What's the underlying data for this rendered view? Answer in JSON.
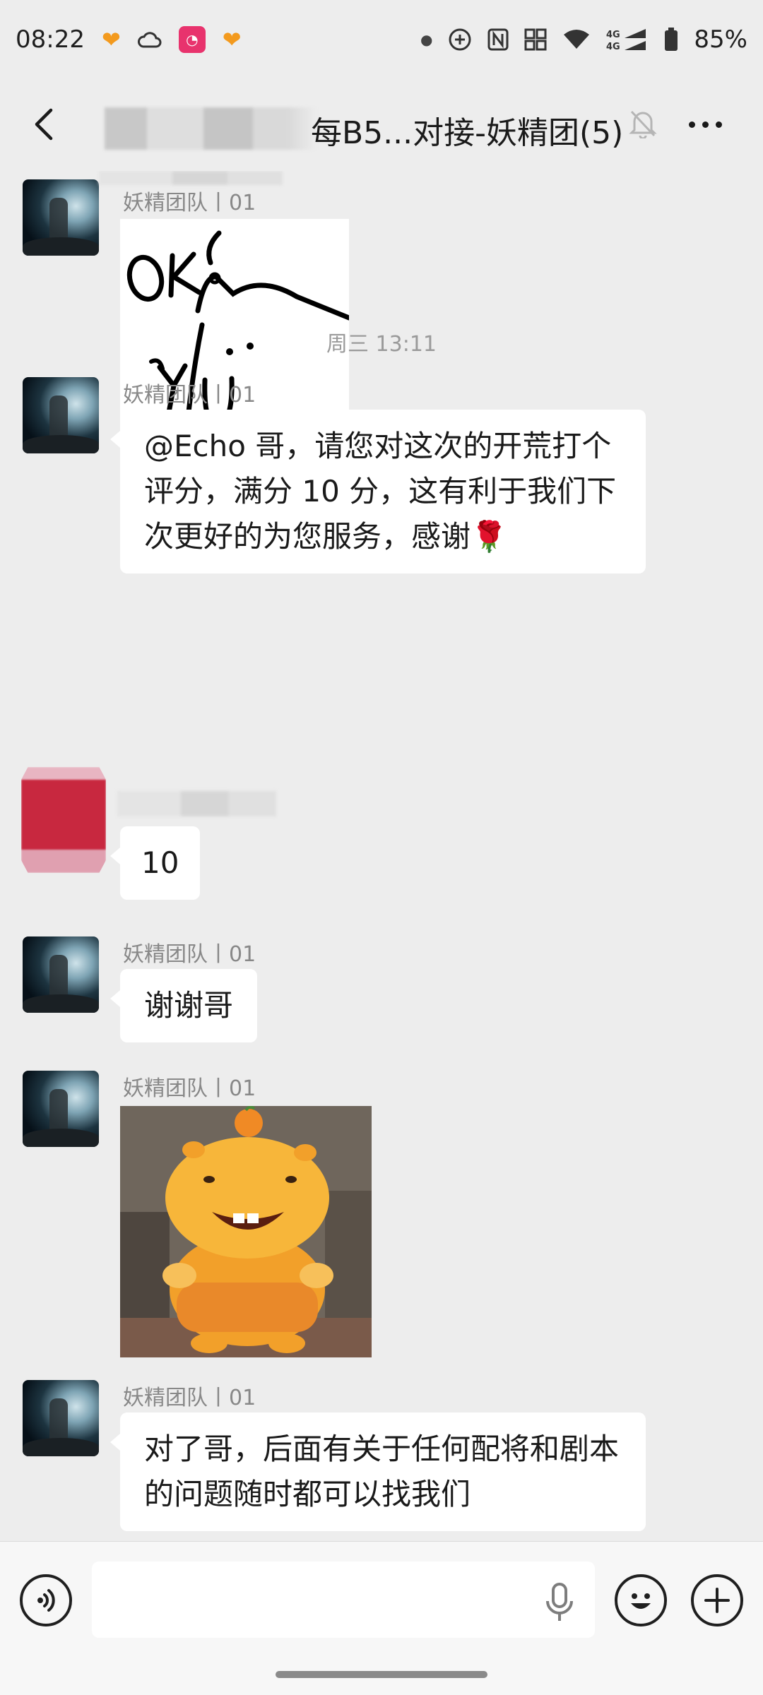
{
  "status_bar": {
    "time": "08:22",
    "battery": "85%",
    "network": "4G",
    "icons": [
      "heart-icon",
      "cloud-icon",
      "app-icon",
      "heart-icon",
      "dot-icon",
      "plus-circle-icon",
      "nfc-icon",
      "sim-icon",
      "wifi-icon",
      "signal-icon",
      "battery-icon"
    ]
  },
  "header": {
    "title": "每B5...对接-妖精团(5)",
    "back_icon": "chevron-left-icon",
    "mute_icon": "bell-off-icon",
    "more_icon": "ellipsis-icon"
  },
  "messages": [
    {
      "sender": "妖精团队丨01",
      "type": "sticker",
      "sticker": "ok-cat-sticker"
    },
    {
      "timestamp": "周三 13:11"
    },
    {
      "sender": "妖精团队丨01",
      "type": "text",
      "text": "@Echo 哥，请您对这次的开荒打个评分，满分 10 分，这有利于我们下次更好的为您服务，感谢🌹"
    },
    {
      "sender": "",
      "type": "text",
      "text": "10"
    },
    {
      "sender": "妖精团队丨01",
      "type": "text",
      "text": "谢谢哥"
    },
    {
      "sender": "妖精团队丨01",
      "type": "sticker",
      "sticker": "orange-hippo-sticker"
    },
    {
      "sender": "妖精团队丨01",
      "type": "text",
      "text": "对了哥，后面有关于任何配将和剧本的问题随时都可以找我们"
    }
  ],
  "input_bar": {
    "voice_icon": "voice-icon",
    "placeholder": "",
    "mic_icon": "mic-icon",
    "emoji_icon": "emoji-icon",
    "plus_icon": "plus-icon"
  }
}
